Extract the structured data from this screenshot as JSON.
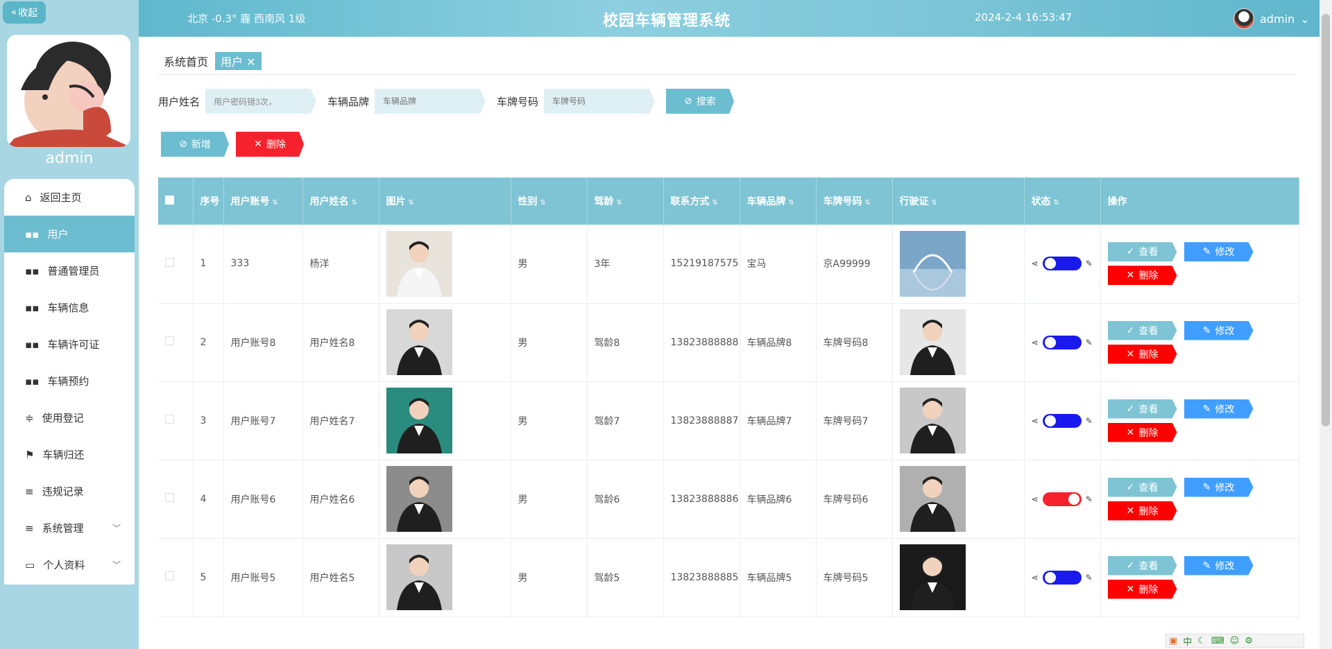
{
  "header": {
    "weather": "北京  -0.3°  霾  西南风  1级",
    "title": "校园车辆管理系统",
    "time": "2024-2-4 16:53:47",
    "user": "admin"
  },
  "sidebar": {
    "collapse_label": "收起",
    "admin_name": "admin",
    "items": [
      {
        "label": "返回主页",
        "icon": "home-icon"
      },
      {
        "label": "用户",
        "icon": "grid-icon"
      },
      {
        "label": "普通管理员",
        "icon": "grid-icon"
      },
      {
        "label": "车辆信息",
        "icon": "grid-icon"
      },
      {
        "label": "车辆许可证",
        "icon": "grid-icon"
      },
      {
        "label": "车辆预约",
        "icon": "grid-icon"
      },
      {
        "label": "使用登记",
        "icon": "sliders-icon"
      },
      {
        "label": "车辆归还",
        "icon": "flag-icon"
      },
      {
        "label": "违规记录",
        "icon": "list-icon"
      },
      {
        "label": "系统管理",
        "icon": "list-icon"
      },
      {
        "label": "个人资料",
        "icon": "card-icon"
      }
    ]
  },
  "breadcrumb": {
    "home": "系统首页",
    "current": "用户"
  },
  "search": {
    "name_label": "用户姓名",
    "name_value": "用户密码错3次，",
    "brand_label": "车辆品牌",
    "brand_placeholder": "车辆品牌",
    "plate_label": "车牌号码",
    "plate_placeholder": "车牌号码",
    "search_label": "搜索"
  },
  "actions": {
    "add_label": "新增",
    "delete_label": "删除"
  },
  "table": {
    "columns": [
      "序号",
      "用户账号",
      "用户姓名",
      "图片",
      "性别",
      "驾龄",
      "联系方式",
      "车辆品牌",
      "车牌号码",
      "行驶证",
      "状态",
      "操作"
    ],
    "rows": [
      {
        "index": "1",
        "account": "333",
        "name": "杨洋",
        "gender": "男",
        "driving_age": "3年",
        "phone": "15219187575",
        "brand": "宝马",
        "plate": "京A99999",
        "status": "off"
      },
      {
        "index": "2",
        "account": "用户账号8",
        "name": "用户姓名8",
        "gender": "男",
        "driving_age": "驾龄8",
        "phone": "13823888888",
        "brand": "车辆品牌8",
        "plate": "车牌号码8",
        "status": "off"
      },
      {
        "index": "3",
        "account": "用户账号7",
        "name": "用户姓名7",
        "gender": "男",
        "driving_age": "驾龄7",
        "phone": "13823888887",
        "brand": "车辆品牌7",
        "plate": "车牌号码7",
        "status": "off"
      },
      {
        "index": "4",
        "account": "用户账号6",
        "name": "用户姓名6",
        "gender": "男",
        "driving_age": "驾龄6",
        "phone": "13823888886",
        "brand": "车辆品牌6",
        "plate": "车牌号码6",
        "status": "on"
      },
      {
        "index": "5",
        "account": "用户账号5",
        "name": "用户姓名5",
        "gender": "男",
        "driving_age": "驾龄5",
        "phone": "13823888885",
        "brand": "车辆品牌5",
        "plate": "车牌号码5",
        "status": "off"
      }
    ],
    "op_view": "查看",
    "op_edit": "修改",
    "op_delete": "删除"
  },
  "colors": {
    "accent": "#6cbdd0",
    "danger": "#f5222d",
    "primary": "#409eff",
    "switch_off": "#1a1aee"
  },
  "ime": {
    "label": "中"
  }
}
